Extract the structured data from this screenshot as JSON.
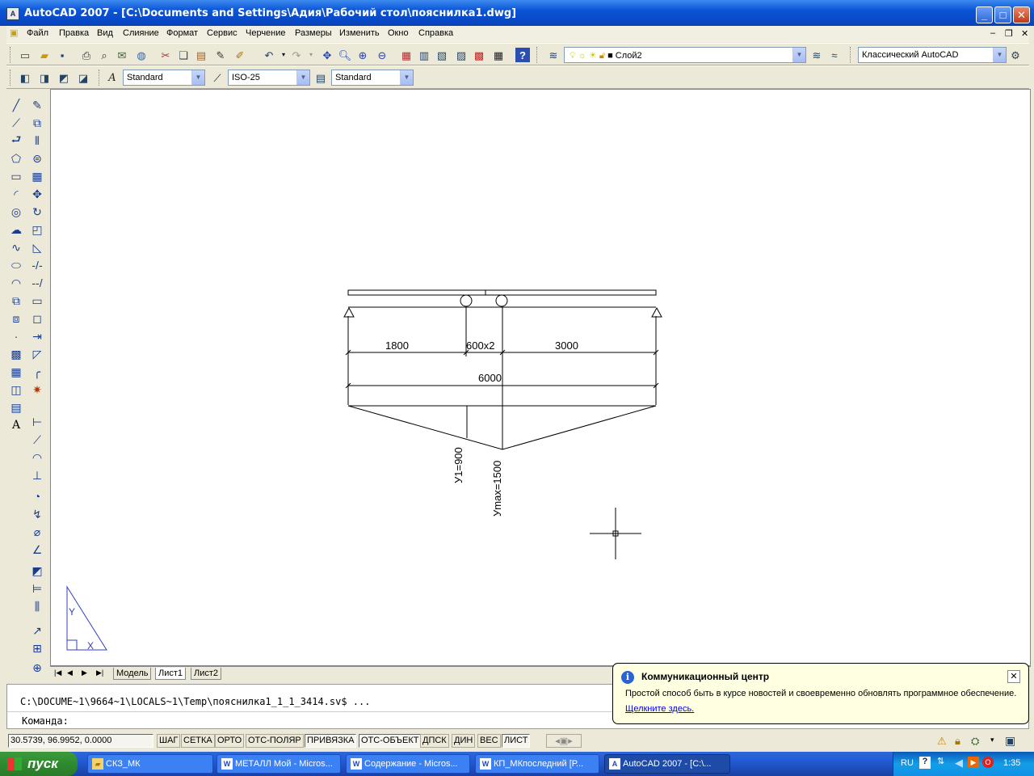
{
  "window": {
    "title": "AutoCAD 2007 - [C:\\Documents and Settings\\Адия\\Рабочий стол\\пояснилка1.dwg]",
    "minimize": "_",
    "maximize": "□",
    "close": "✕"
  },
  "menu": {
    "items": [
      "Файл",
      "Правка",
      "Вид",
      "Слияние",
      "Формат",
      "Сервис",
      "Черчение",
      "Размеры",
      "Изменить",
      "Окно",
      "Справка"
    ]
  },
  "toolbar": {
    "layer_combo": "Слой2",
    "workspace_combo": "Классический AutoCAD",
    "text_style_combo": "Standard",
    "dim_style_combo": "ISO-25",
    "table_style_combo": "Standard"
  },
  "drawing": {
    "dim_1800": "1800",
    "dim_600x2": "600x2",
    "dim_3000": "3000",
    "dim_6000": "6000",
    "label_y1": "У1=900",
    "label_ymax": "Уmax=1500",
    "ucs_y": "Y",
    "ucs_x": "X"
  },
  "layout_tabs": [
    "Модель",
    "Лист1",
    "Лист2"
  ],
  "command": {
    "line1": "C:\\DOCUME~1\\9664~1\\LOCALS~1\\Temp\\пояснилка1_1_1_3414.sv$ ...",
    "line2": "Команда:"
  },
  "status": {
    "coords": "30.5739, 96.9952, 0.0000",
    "buttons": [
      "ШАГ",
      "СЕТКА",
      "ОРТО",
      "ОТС-ПОЛЯР",
      "ПРИВЯЗКА",
      "ОТС-ОБЪЕКТ",
      "ДПСК",
      "ДИН",
      "ВЕС",
      "ЛИСТ"
    ]
  },
  "balloon": {
    "title": "Коммуникационный центр",
    "text": "Простой способ быть в курсе новостей и своевременно обновлять программное обеспечение.",
    "link": "Щелкните здесь."
  },
  "taskbar": {
    "start": "пуск",
    "tasks": [
      "СКЗ_МК",
      "МЕТАЛЛ Мой - Micros...",
      "Содержание - Micros...",
      "КП_МКпоследний [Р...",
      "AutoCAD 2007 - [C:\\..."
    ],
    "lang": "RU",
    "clock": "1:35"
  }
}
